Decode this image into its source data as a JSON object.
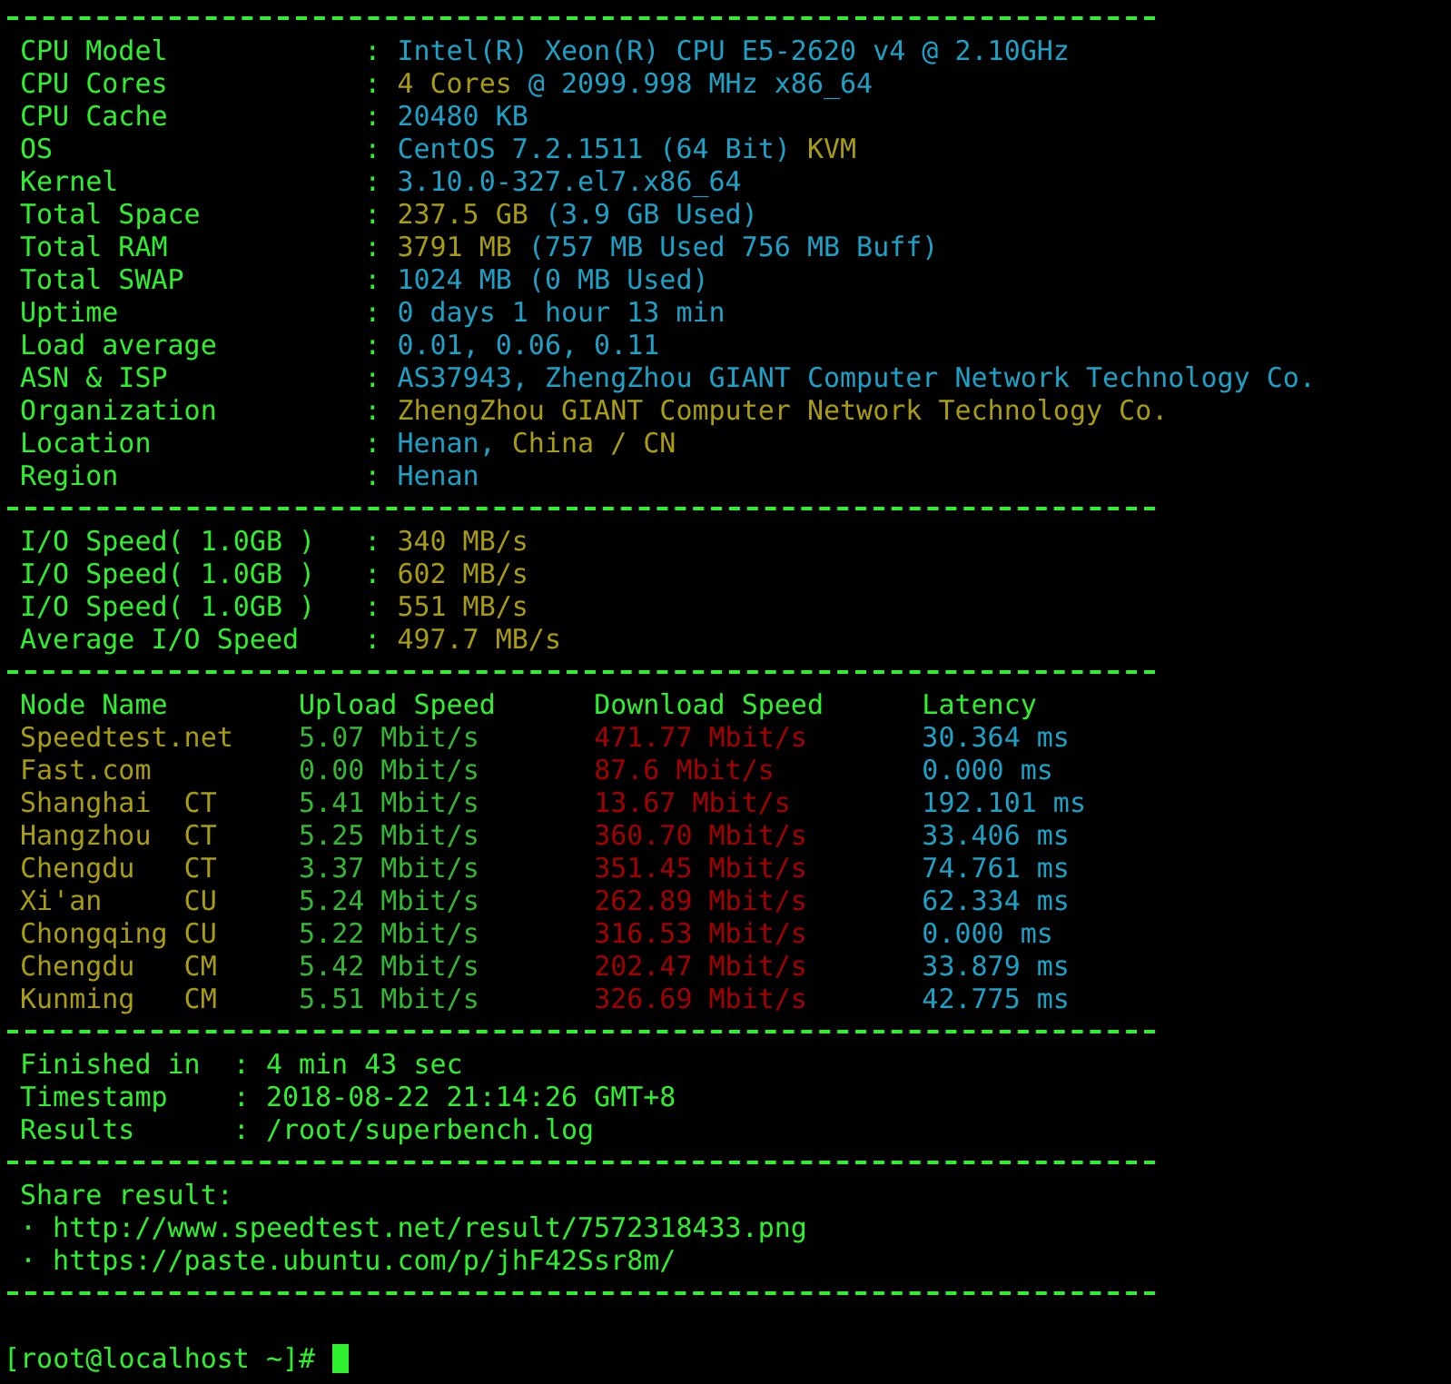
{
  "system_info": [
    {
      "label": "CPU Model",
      "sep": ":",
      "value": [
        {
          "text": "Intel(R) Xeon(R) CPU E5-2620 v4 @ 2.10GHz",
          "color": "#1ba2c6"
        }
      ]
    },
    {
      "label": "CPU Cores",
      "sep": ":",
      "value": [
        {
          "text": "4 Cores",
          "color": "#a89c12"
        },
        {
          "text": "@ 2099.998 MHz x86_64",
          "color": "#1ba2c6"
        }
      ]
    },
    {
      "label": "CPU Cache",
      "sep": ":",
      "value": [
        {
          "text": "20480 KB",
          "color": "#1ba2c6"
        }
      ]
    },
    {
      "label": "OS",
      "sep": ":",
      "value": [
        {
          "text": "CentOS 7.2.1511 (64 Bit)",
          "color": "#1ba2c6"
        },
        {
          "text": "KVM",
          "color": "#a89c12"
        }
      ]
    },
    {
      "label": "Kernel",
      "sep": ":",
      "value": [
        {
          "text": "3.10.0-327.el7.x86_64",
          "color": "#1ba2c6"
        }
      ]
    },
    {
      "label": "Total Space",
      "sep": ":",
      "value": [
        {
          "text": "237.5 GB",
          "color": "#a89c12"
        },
        {
          "text": "(3.9 GB Used)",
          "color": "#1ba2c6"
        }
      ]
    },
    {
      "label": "Total RAM",
      "sep": ":",
      "value": [
        {
          "text": "3791 MB",
          "color": "#a89c12"
        },
        {
          "text": "(757 MB Used 756 MB Buff)",
          "color": "#1ba2c6"
        }
      ]
    },
    {
      "label": "Total SWAP",
      "sep": ":",
      "value": [
        {
          "text": "1024 MB (0 MB Used)",
          "color": "#1ba2c6"
        }
      ]
    },
    {
      "label": "Uptime",
      "sep": ":",
      "value": [
        {
          "text": "0 days 1 hour 13 min",
          "color": "#1ba2c6"
        }
      ]
    },
    {
      "label": "Load average",
      "sep": ":",
      "value": [
        {
          "text": "0.01, 0.06, 0.11",
          "color": "#1ba2c6"
        }
      ]
    },
    {
      "label": "ASN & ISP",
      "sep": ":",
      "value": [
        {
          "text": "AS37943, ZhengZhou GIANT Computer Network Technology Co.",
          "color": "#1ba2c6"
        }
      ]
    },
    {
      "label": "Organization",
      "sep": ":",
      "value": [
        {
          "text": "ZhengZhou GIANT Computer Network Technology Co.",
          "color": "#a89c12"
        }
      ]
    },
    {
      "label": "Location",
      "sep": ":",
      "value": [
        {
          "text": "Henan,",
          "color": "#1ba2c6"
        },
        {
          "text": "China / CN",
          "color": "#a89c12"
        }
      ]
    },
    {
      "label": "Region",
      "sep": ":",
      "value": [
        {
          "text": "Henan",
          "color": "#1ba2c6"
        }
      ]
    }
  ],
  "io_speed": [
    {
      "label": "I/O Speed( 1.0GB )",
      "sep": ":",
      "value": [
        {
          "text": "340 MB/s",
          "color": "#a89c12"
        }
      ]
    },
    {
      "label": "I/O Speed( 1.0GB )",
      "sep": ":",
      "value": [
        {
          "text": "602 MB/s",
          "color": "#a89c12"
        }
      ]
    },
    {
      "label": "I/O Speed( 1.0GB )",
      "sep": ":",
      "value": [
        {
          "text": "551 MB/s",
          "color": "#a89c12"
        }
      ]
    },
    {
      "label": "Average I/O Speed",
      "sep": ":",
      "value": [
        {
          "text": "497.7 MB/s",
          "color": "#a89c12"
        }
      ]
    }
  ],
  "speed_table": {
    "columns": [
      "Node Name",
      "Upload Speed",
      "Download Speed",
      "Latency"
    ],
    "rows": [
      {
        "node": "Speedtest.net",
        "upload": "5.07 Mbit/s",
        "download": "471.77 Mbit/s",
        "latency": "30.364 ms"
      },
      {
        "node": "Fast.com",
        "upload": "0.00 Mbit/s",
        "download": "87.6 Mbit/s",
        "latency": "0.000 ms"
      },
      {
        "node": "Shanghai",
        "isp": "CT",
        "upload": "5.41 Mbit/s",
        "download": "13.67 Mbit/s",
        "latency": "192.101 ms"
      },
      {
        "node": "Hangzhou",
        "isp": "CT",
        "upload": "5.25 Mbit/s",
        "download": "360.70 Mbit/s",
        "latency": "33.406 ms"
      },
      {
        "node": "Chengdu",
        "isp": "CT",
        "upload": "3.37 Mbit/s",
        "download": "351.45 Mbit/s",
        "latency": "74.761 ms"
      },
      {
        "node": "Xi'an",
        "isp": "CU",
        "upload": "5.24 Mbit/s",
        "download": "262.89 Mbit/s",
        "latency": "62.334 ms"
      },
      {
        "node": "Chongqing",
        "isp": "CU",
        "upload": "5.22 Mbit/s",
        "download": "316.53 Mbit/s",
        "latency": "0.000 ms"
      },
      {
        "node": "Chengdu",
        "isp": "CM",
        "upload": "5.42 Mbit/s",
        "download": "202.47 Mbit/s",
        "latency": "33.879 ms"
      },
      {
        "node": "Kunming",
        "isp": "CM",
        "upload": "5.51 Mbit/s",
        "download": "326.69 Mbit/s",
        "latency": "42.775 ms"
      }
    ]
  },
  "summary": [
    {
      "label": "Finished in",
      "sep": ":",
      "value": [
        {
          "text": "4 min 43 sec",
          "color": "#2ef02e"
        }
      ]
    },
    {
      "label": "Timestamp",
      "sep": ":",
      "value": [
        {
          "text": "2018-08-22 21:14:26 GMT+8",
          "color": "#2ef02e"
        }
      ]
    },
    {
      "label": "Results",
      "sep": ":",
      "value": [
        {
          "text": "/root/superbench.log",
          "color": "#2ef02e"
        }
      ]
    }
  ],
  "share": {
    "title": "Share result:",
    "links": [
      {
        "bullet": "·",
        "url": "http://www.speedtest.net/result/7572318433.png"
      },
      {
        "bullet": "·",
        "url": "https://paste.ubuntu.com/p/jhF42Ssr8m/"
      }
    ]
  },
  "prompt": {
    "text": "[root@localhost ~]#"
  }
}
